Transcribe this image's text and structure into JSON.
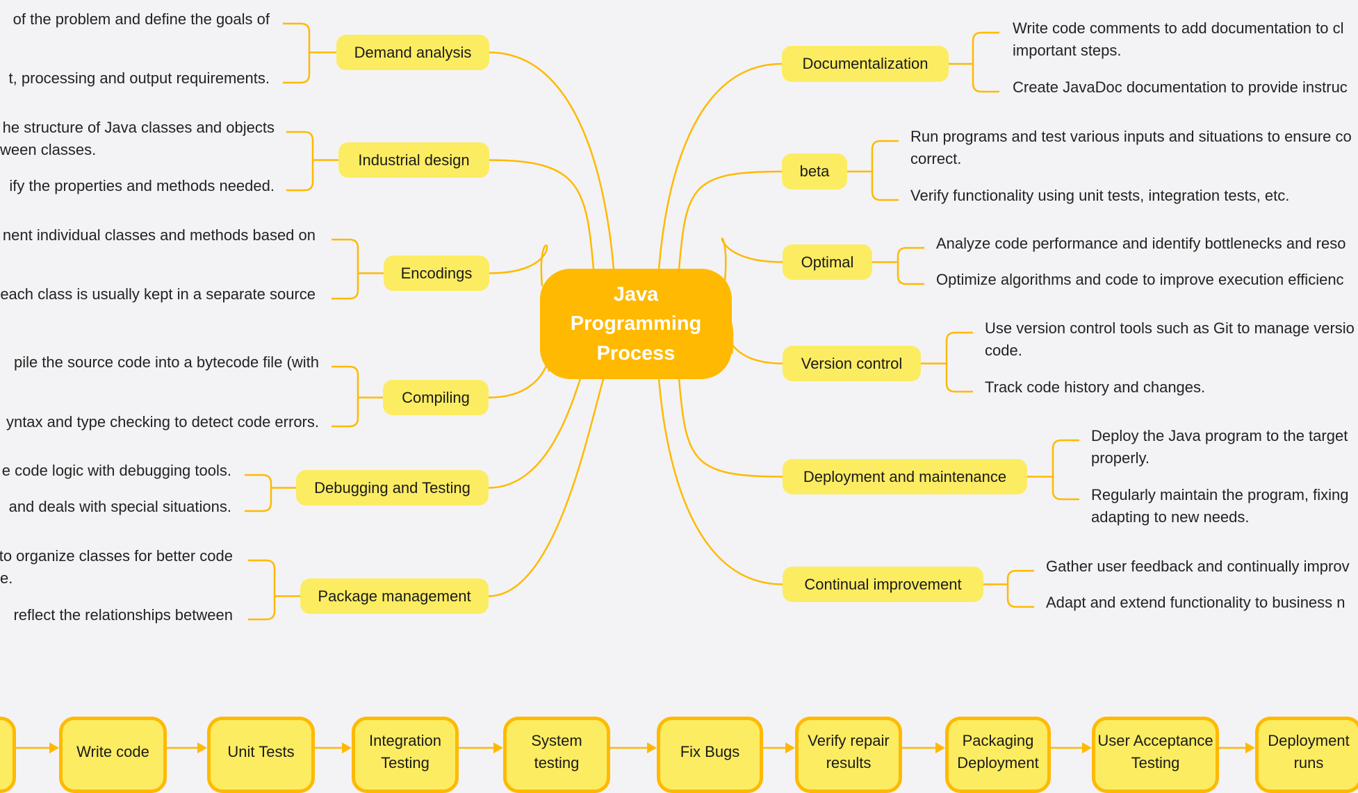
{
  "colors": {
    "center": "#FFB900",
    "node": "#FCEC62",
    "line": "#FFB900",
    "background": "#F3F3F5"
  },
  "center": {
    "title": "Java Programming Process"
  },
  "left_branches": [
    {
      "label": "Demand analysis",
      "leaves": [
        "of the problem and define the goals of",
        "t, processing and output requirements."
      ]
    },
    {
      "label": "Industrial design",
      "leaves": [
        "he structure of Java classes and objects\nween classes.",
        "ify the properties and methods needed."
      ]
    },
    {
      "label": "Encodings",
      "leaves": [
        "nent individual classes and methods based on",
        "each class is usually kept in a separate source"
      ]
    },
    {
      "label": "Compiling",
      "leaves": [
        "pile the source code into a bytecode file (with",
        "yntax and type checking to detect code errors."
      ]
    },
    {
      "label": "Debugging and Testing",
      "leaves": [
        "e code logic with debugging tools.",
        "and deals with special situations."
      ]
    },
    {
      "label": "Package management",
      "leaves": [
        "to organize classes for better code\ne.",
        "reflect the relationships between"
      ]
    }
  ],
  "right_branches": [
    {
      "label": "Documentalization",
      "leaves": [
        "Write code comments to add documentation to cl\nimportant steps.",
        "Create JavaDoc documentation to provide instruc"
      ]
    },
    {
      "label": "beta",
      "leaves": [
        "Run programs and test various inputs and situations to ensure co\ncorrect.",
        "Verify functionality using unit tests, integration tests, etc."
      ]
    },
    {
      "label": "Optimal",
      "leaves": [
        "Analyze code performance and identify bottlenecks and reso",
        "Optimize algorithms and code to improve execution efficienc"
      ]
    },
    {
      "label": "Version control",
      "leaves": [
        "Use version control tools such as Git to manage versio\ncode.",
        "Track code history and changes."
      ]
    },
    {
      "label": "Deployment and maintenance",
      "leaves": [
        "Deploy the Java program to the target\nproperly.",
        "Regularly maintain the program, fixing\nadapting to new needs."
      ]
    },
    {
      "label": "Continual improvement",
      "leaves": [
        "Gather user feedback and continually improv",
        "Adapt and extend functionality to business n"
      ]
    }
  ],
  "flow": [
    {
      "label": ""
    },
    {
      "label": "Write code"
    },
    {
      "label": "Unit Tests"
    },
    {
      "label": "Integration Testing"
    },
    {
      "label": "System testing"
    },
    {
      "label": "Fix Bugs"
    },
    {
      "label": "Verify repair results"
    },
    {
      "label": "Packaging Deployment"
    },
    {
      "label": "User Acceptance Testing"
    },
    {
      "label": "Deployment runs"
    }
  ]
}
